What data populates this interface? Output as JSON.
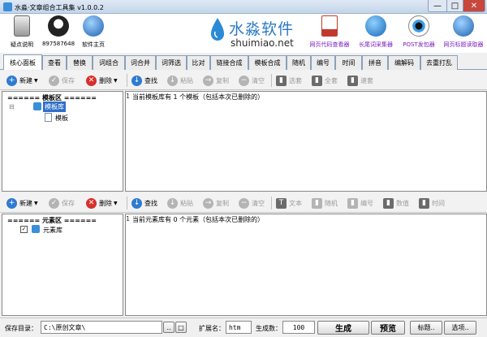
{
  "window": {
    "title": "水淼·文章组合工具集 v1.0.0.2",
    "min": "—",
    "max": "□",
    "close": "✕"
  },
  "header": {
    "items": [
      {
        "label": "疑点说明"
      },
      {
        "label": "897587648"
      },
      {
        "label": "软件主页"
      },
      {
        "label": "网页代码查看器"
      },
      {
        "label": "长尾词采集器"
      },
      {
        "label": "POST发包器"
      },
      {
        "label": "网页标题读取器"
      }
    ],
    "logo": {
      "cn": "水淼软件",
      "en": "shuimiao.net"
    },
    "accent": "#7a1fbf"
  },
  "tabs": [
    "核心面板",
    "查看",
    "替换",
    "词组合",
    "词合并",
    "词筛选",
    "比对",
    "链接合成",
    "模板合成",
    "随机",
    "编号",
    "时间",
    "拼音",
    "编解码",
    "去重打乱"
  ],
  "toolbar1": {
    "new": "新建",
    "save": "保存",
    "delete": "删除",
    "find": "查找",
    "paste": "粘贴",
    "copy": "复制",
    "clear": "清空",
    "select": "选套",
    "all": "全套",
    "retrieve": "速套"
  },
  "toolbar2": {
    "new": "新建",
    "save": "保存",
    "delete": "删除",
    "find": "查找",
    "paste": "粘贴",
    "copy": "复制",
    "clear": "清空",
    "text": "文本",
    "random": "随机",
    "number": "编号",
    "value": "数值",
    "time": "时间"
  },
  "template_tree": {
    "header": "====== 模板区 ======",
    "folder": "模板库",
    "item": "模板",
    "expander": "⊟"
  },
  "template_content": {
    "line_no": "1",
    "text": "当前模板库有 1 个模板（包括本次已删除的）"
  },
  "element_tree": {
    "header": "====== 元素区 ======",
    "item": "元素库",
    "check": "✓"
  },
  "element_content": {
    "line_no": "1",
    "text": "当前元素库有 0 个元素（包括本次已删除的）"
  },
  "status": {
    "dir_label": "保存目录：",
    "dir_value": "C:\\原创文章\\",
    "browse": "..",
    "open": "□",
    "ext_label": "扩展名：",
    "ext_value": "htm",
    "count_label": "生成数：",
    "count_value": "100",
    "generate": "生成",
    "preview": "预览",
    "title_btn": "标题..",
    "options": "选项.."
  }
}
